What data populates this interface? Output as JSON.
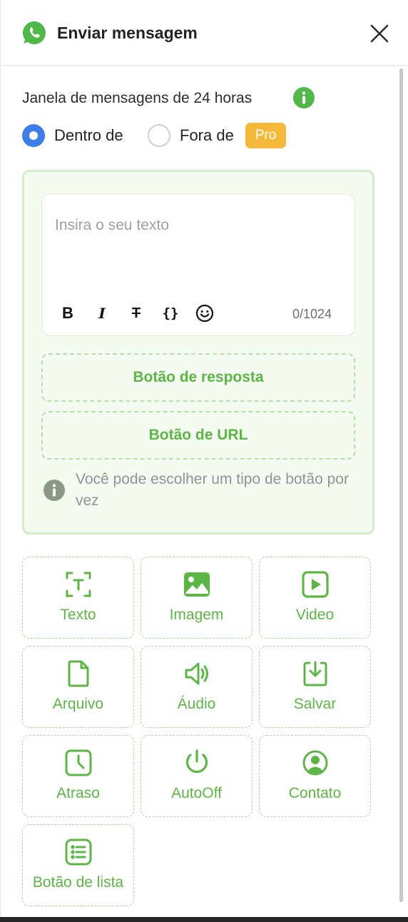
{
  "header": {
    "title": "Enviar mensagem"
  },
  "window": {
    "label": "Janela de mensagens de 24 horas",
    "option_in": "Dentro de",
    "option_out": "Fora de",
    "pro_badge": "Pro",
    "selected": "Dentro de"
  },
  "editor": {
    "placeholder": "Insira o seu texto",
    "bold": "B",
    "italic": "I",
    "strike": "T",
    "code": "{}",
    "char_count": "0/1024"
  },
  "buttons": {
    "reply": "Botão de resposta",
    "url": "Botão de URL",
    "hint": "Você pode escolher um tipo de botão por vez"
  },
  "tiles": [
    {
      "label": "Texto",
      "icon": "text-icon"
    },
    {
      "label": "Imagem",
      "icon": "image-icon"
    },
    {
      "label": "Video",
      "icon": "video-icon"
    },
    {
      "label": "Arquivo",
      "icon": "file-icon"
    },
    {
      "label": "Áudio",
      "icon": "audio-icon"
    },
    {
      "label": "Salvar",
      "icon": "save-icon"
    },
    {
      "label": "Atraso",
      "icon": "delay-icon"
    },
    {
      "label": "AutoOff",
      "icon": "power-icon"
    },
    {
      "label": "Contato",
      "icon": "contact-icon"
    },
    {
      "label": "Botão de lista",
      "icon": "list-icon"
    }
  ],
  "colors": {
    "accent_green": "#5db545",
    "radio_blue": "#3d7de8",
    "pro_yellow": "#f4b93a",
    "whatsapp_green": "#4fb848"
  }
}
